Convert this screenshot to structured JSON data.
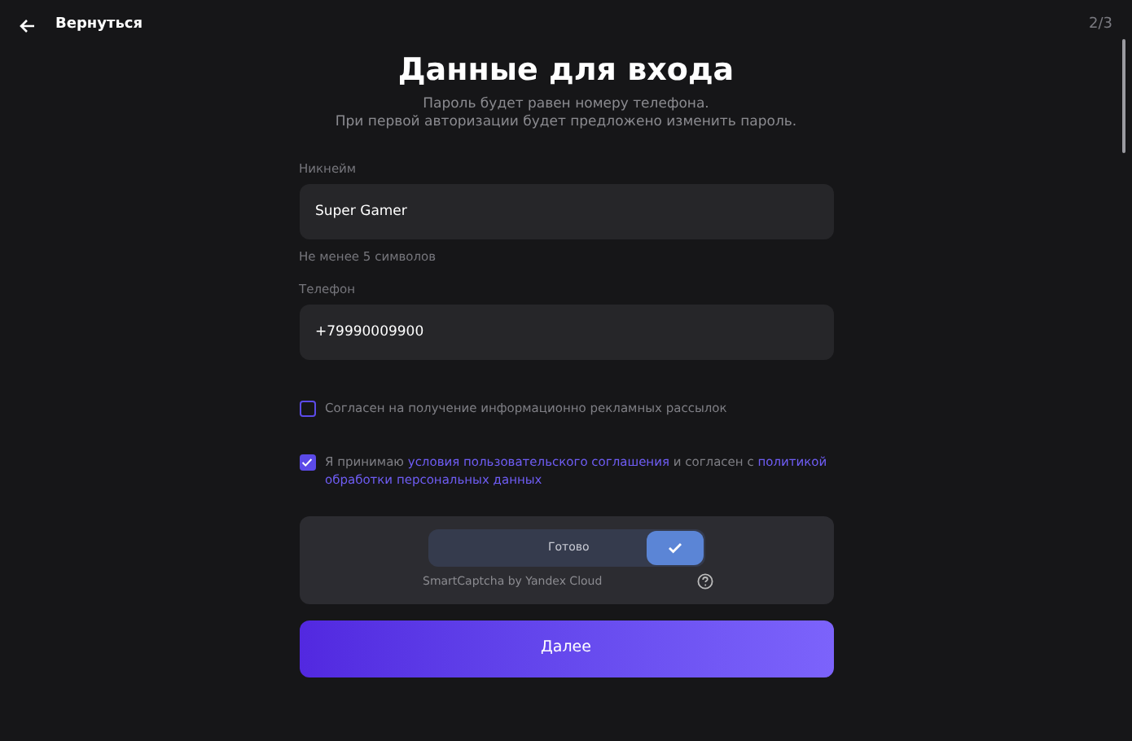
{
  "header": {
    "back_label": "Вернуться",
    "step": "2/3"
  },
  "title": "Данные для входа",
  "subtitle": [
    "Пароль будет равен номеру телефона.",
    "При первой авторизации будет предложено изменить пароль."
  ],
  "fields": [
    {
      "label": "Никнейм",
      "value": "Super Gamer",
      "hint": "Не менее 5 символов"
    },
    {
      "label": "Телефон",
      "value": "+79990009900"
    }
  ],
  "checkboxes": [
    {
      "checked": false,
      "parts": [
        {
          "text": "Согласен на получение информационно рекламных рассылок",
          "link": false
        }
      ]
    },
    {
      "checked": true,
      "parts": [
        {
          "text": "Я принимаю ",
          "link": false
        },
        {
          "text": "условия пользовательского соглашения",
          "link": true
        },
        {
          "text": " и согласен с ",
          "link": false
        },
        {
          "text": "политикой",
          "link": true
        },
        {
          "text": "обработки персональных данных",
          "link": true
        }
      ]
    }
  ],
  "captcha": {
    "label": "Готово",
    "checked": true,
    "provider": "SmartCaptcha by Yandex Cloud"
  },
  "submit": "Далее"
}
